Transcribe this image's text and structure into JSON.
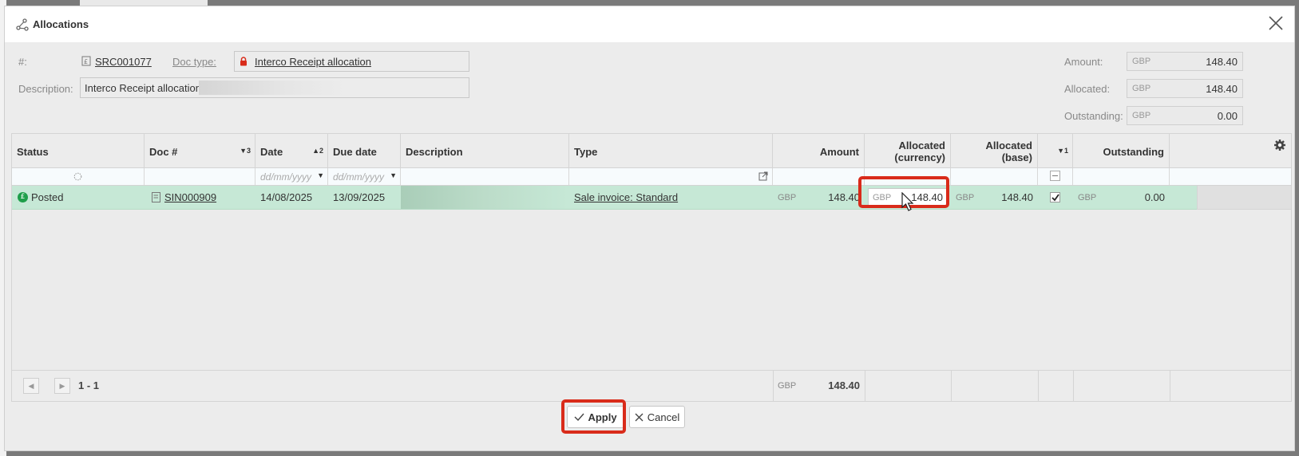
{
  "dialog": {
    "title": "Allocations",
    "close_icon": "close-icon"
  },
  "header": {
    "number_label": "#:",
    "doc_number": "SRC001077",
    "doc_type_label": "Doc type:",
    "doc_type_value": "Interco Receipt allocation",
    "description_label": "Description:",
    "description_value": "Interco Receipt allocation",
    "amount_label": "Amount:",
    "amount_currency": "GBP",
    "amount_value": "148.40",
    "allocated_label": "Allocated:",
    "allocated_currency": "GBP",
    "allocated_value": "148.40",
    "outstanding_label": "Outstanding:",
    "outstanding_currency": "GBP",
    "outstanding_value": "0.00"
  },
  "grid": {
    "columns": {
      "status": "Status",
      "doc_no": "Doc #",
      "doc_no_sort": "▼3",
      "date": "Date",
      "date_sort": "▲2",
      "due_date": "Due date",
      "description": "Description",
      "type": "Type",
      "amount": "Amount",
      "allocated_currency_l1": "Allocated",
      "allocated_currency_l2": "(currency)",
      "allocated_base_l1": "Allocated",
      "allocated_base_l2": "(base)",
      "check_sort": "▼1",
      "outstanding": "Outstanding"
    },
    "filter_date_placeholder": "dd/mm/yyyy",
    "filter_due_placeholder": "dd/mm/yyyy",
    "rows": [
      {
        "status": "Posted",
        "doc_no": "SIN000909",
        "date": "14/08/2025",
        "due_date": "13/09/2025",
        "description": "",
        "type": "Sale invoice: Standard",
        "amount_currency": "GBP",
        "amount": "148.40",
        "alloc_currency": "GBP",
        "alloc_value": "148.40",
        "alloc_base_currency": "GBP",
        "alloc_base": "148.40",
        "checked": true,
        "outstanding_currency": "GBP",
        "outstanding": "0.00"
      }
    ],
    "footer": {
      "page_range": "1 - 1",
      "total_currency": "GBP",
      "total_amount": "148.40"
    }
  },
  "buttons": {
    "apply": "Apply",
    "cancel": "Cancel"
  },
  "colors": {
    "highlight": "#d92b1a",
    "row_green": "#c6e8d6",
    "status_green": "#1e9e4a"
  }
}
